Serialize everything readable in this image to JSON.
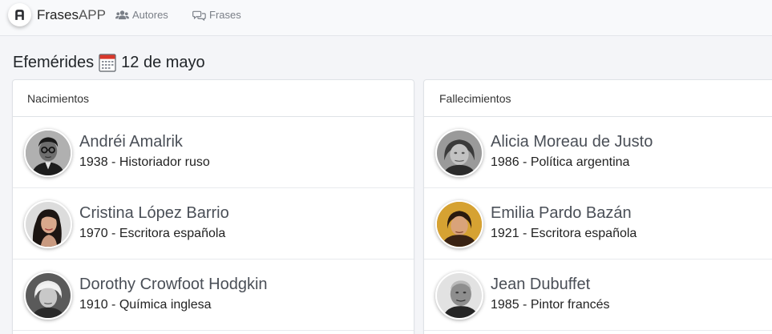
{
  "navbar": {
    "brand_strong": "Frases",
    "brand_light": "APP",
    "links": [
      {
        "label": "Autores",
        "icon": "users-icon"
      },
      {
        "label": "Frases",
        "icon": "comments-icon"
      }
    ]
  },
  "heading": {
    "title": "Efemérides",
    "icon": "calendar-icon",
    "date": "12 de mayo"
  },
  "births": {
    "header": "Nacimientos",
    "items": [
      {
        "name": "Andréi Amalrik",
        "desc": "1938 - Historiador ruso"
      },
      {
        "name": "Cristina López Barrio",
        "desc": "1970 - Escritora española"
      },
      {
        "name": "Dorothy Crowfoot Hodgkin",
        "desc": "1910 - Química inglesa"
      }
    ]
  },
  "deaths": {
    "header": "Fallecimientos",
    "items": [
      {
        "name": "Alicia Moreau de Justo",
        "desc": "1986 - Política argentina"
      },
      {
        "name": "Emilia Pardo Bazán",
        "desc": "1921 - Escritora española"
      },
      {
        "name": "Jean Dubuffet",
        "desc": "1985 - Pintor francés"
      }
    ]
  }
}
